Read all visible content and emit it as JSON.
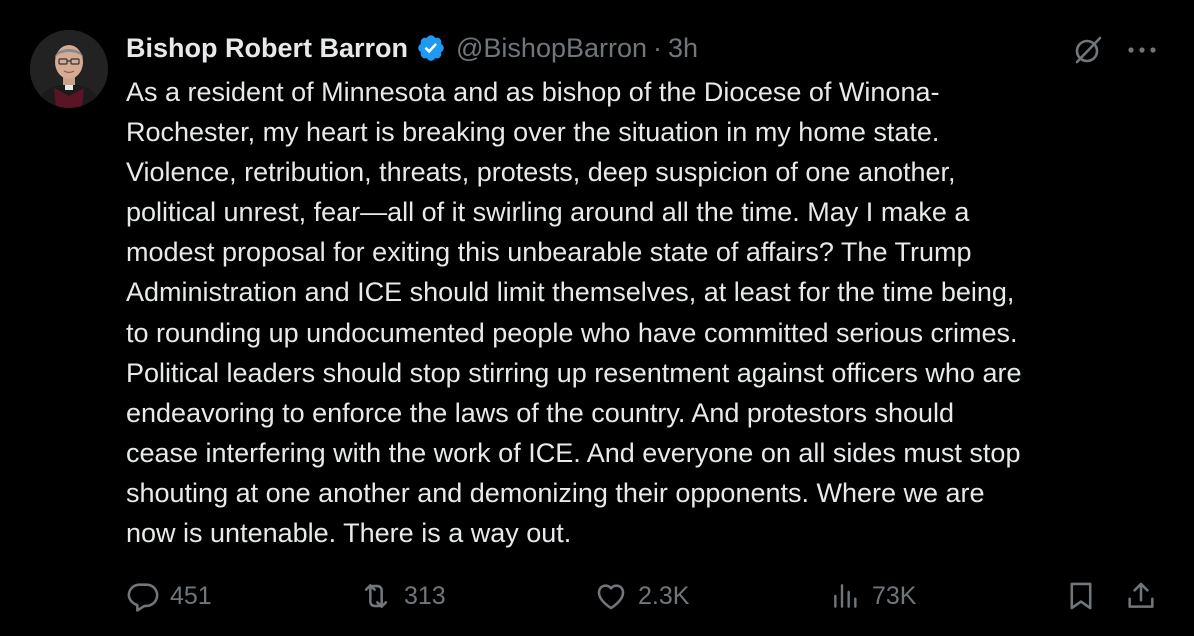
{
  "author": {
    "display_name": "Bishop Robert Barron",
    "handle": "@BishopBarron",
    "separator": "·",
    "time": "3h",
    "avatar_icon": "bishop-portrait-avatar",
    "verified_icon": "verified-badge-icon",
    "verified_color": "#1d9bf0"
  },
  "header_actions": {
    "grok_icon": "grok-icon",
    "more_icon": "more-icon"
  },
  "tweet": {
    "lines": [
      "As a resident of Minnesota and as bishop of the Diocese of Winona-",
      "Rochester, my heart is breaking over the situation in my home state.",
      "Violence, retribution, threats, protests, deep suspicion of one another,",
      "political unrest, fear—all of it swirling around all the time. May I make a",
      "modest proposal for exiting this unbearable state of affairs? The Trump",
      "Administration and ICE should limit themselves, at least for the time being,",
      "to rounding up undocumented people who have committed serious crimes.",
      "Political leaders should stop stirring up resentment against officers who are",
      "endeavoring to enforce the laws of the country. And protestors should",
      "cease interfering with the work of ICE.  And everyone on all sides must stop",
      "shouting at one another and demonizing their opponents. Where we are",
      "now is untenable. There is a way out."
    ]
  },
  "actions": {
    "reply": {
      "icon": "reply-icon",
      "count": "451"
    },
    "repost": {
      "icon": "repost-icon",
      "count": "313"
    },
    "like": {
      "icon": "like-icon",
      "count": "2.3K"
    },
    "views": {
      "icon": "views-icon",
      "count": "73K"
    },
    "bookmark": {
      "icon": "bookmark-icon"
    },
    "share": {
      "icon": "share-icon"
    }
  },
  "colors": {
    "background": "#000000",
    "text_primary": "#e7e9ea",
    "text_secondary": "#71767b"
  }
}
